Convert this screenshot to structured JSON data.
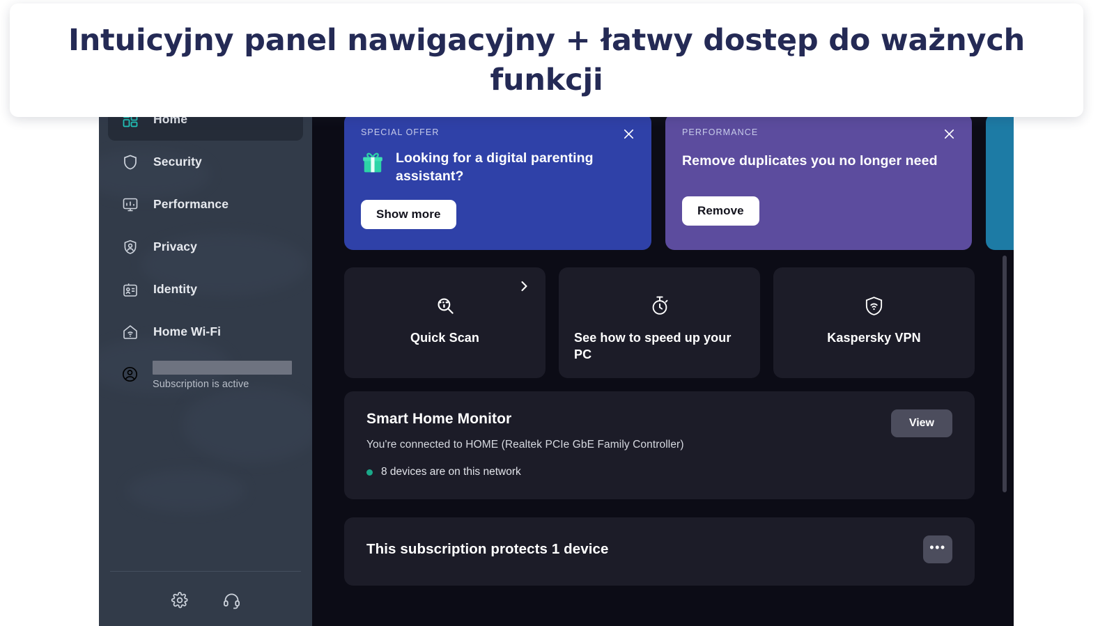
{
  "banner": {
    "headline": "Intuicyjny panel nawigacyjny + łatwy dostęp do ważnych funkcji"
  },
  "sidebar": {
    "items": [
      {
        "label": "Home",
        "icon": "home-dashboard-icon",
        "active": true
      },
      {
        "label": "Security",
        "icon": "shield-icon",
        "active": false
      },
      {
        "label": "Performance",
        "icon": "monitor-chart-icon",
        "active": false
      },
      {
        "label": "Privacy",
        "icon": "privacy-shield-user-icon",
        "active": false
      },
      {
        "label": "Identity",
        "icon": "id-card-icon",
        "active": false
      },
      {
        "label": "Home Wi-Fi",
        "icon": "house-wifi-icon",
        "active": false
      }
    ],
    "account": {
      "icon": "user-circle-icon",
      "name_redacted": "",
      "status": "Subscription is active"
    },
    "footer": [
      {
        "icon": "gear-icon",
        "name": "settings"
      },
      {
        "icon": "headset-icon",
        "name": "support"
      }
    ]
  },
  "promos": [
    {
      "kicker": "SPECIAL OFFER",
      "title": "Looking for a digital parenting assistant?",
      "button": "Show more",
      "icon": "gift-icon",
      "color": "#2f41a8",
      "close": "×"
    },
    {
      "kicker": "PERFORMANCE",
      "title": "Remove duplicates you no longer need",
      "button": "Remove",
      "icon": "",
      "color": "#5c4c9e",
      "close": "×"
    },
    {
      "kicker": "",
      "title": "",
      "button": "",
      "icon": "",
      "color": "#1d7ba5",
      "close": ""
    }
  ],
  "tiles": [
    {
      "label": "Quick Scan",
      "icon": "scan-magnifier-icon",
      "chevron": "›"
    },
    {
      "label": "See how to speed up your PC",
      "icon": "stopwatch-icon",
      "chevron": ""
    },
    {
      "label": "Kaspersky VPN",
      "icon": "shield-wifi-icon",
      "chevron": ""
    }
  ],
  "smart_home": {
    "title": "Smart Home Monitor",
    "subtitle": "You're connected to HOME (Realtek PCIe GbE Family Controller)",
    "status": "8 devices are on this network",
    "action": "View",
    "status_color": "#1aa889"
  },
  "subscription_panel": {
    "title": "This subscription protects 1 device",
    "menu": "•••"
  },
  "colors": {
    "sidebar_bg": "#323b49",
    "content_bg": "#0c0c16",
    "card_bg": "#1c1c28",
    "accent_teal": "#22c7bb",
    "banner_text": "#242a55"
  }
}
